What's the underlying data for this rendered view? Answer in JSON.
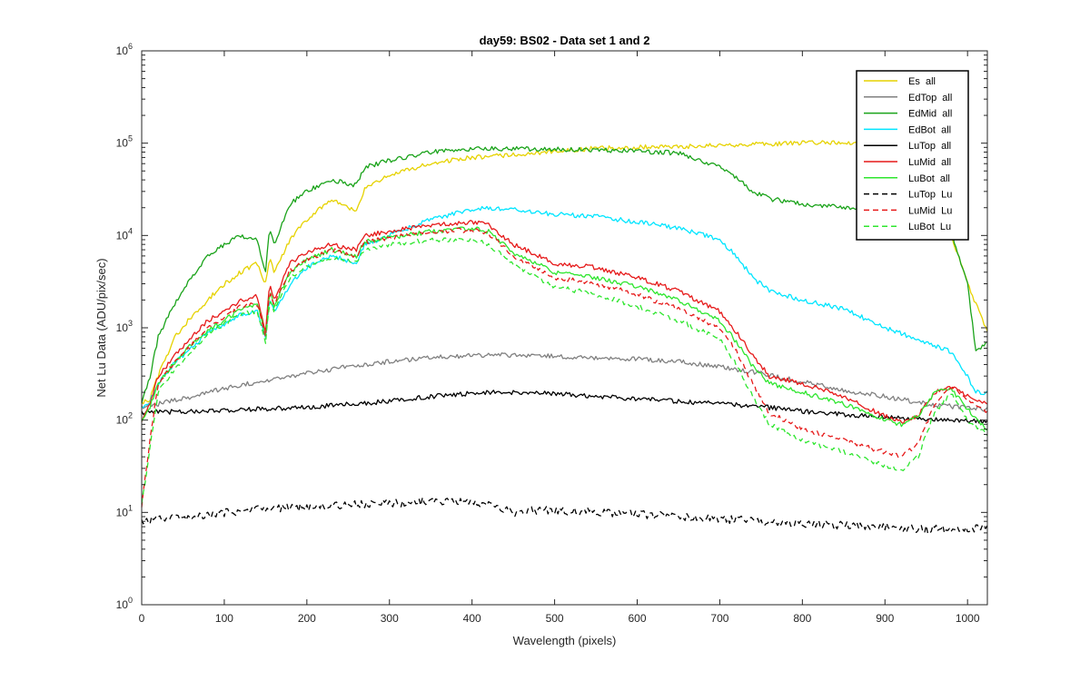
{
  "chart_data": {
    "type": "line",
    "title": "day59: BS02 - Data set 1 and 2",
    "xlabel": "Wavelength (pixels)",
    "ylabel": "Net Lu Data (ADU/pix/sec)",
    "xlim": [
      0,
      1024
    ],
    "ylim": [
      1,
      1000000
    ],
    "yscale": "log",
    "xticks": [
      0,
      100,
      200,
      300,
      400,
      500,
      600,
      700,
      800,
      900,
      1000
    ],
    "yticks": [
      {
        "value": 1,
        "base": "10",
        "exp": "0"
      },
      {
        "value": 10,
        "base": "10",
        "exp": "1"
      },
      {
        "value": 100,
        "base": "10",
        "exp": "2"
      },
      {
        "value": 1000,
        "base": "10",
        "exp": "3"
      },
      {
        "value": 10000,
        "base": "10",
        "exp": "4"
      },
      {
        "value": 100000,
        "base": "10",
        "exp": "5"
      },
      {
        "value": 1000000,
        "base": "10",
        "exp": "6"
      }
    ],
    "grid": false,
    "legend_position": "top-right",
    "series": [
      {
        "name": "Es  all",
        "color": "#e6d200",
        "dash": "solid",
        "x": [
          0,
          10,
          20,
          40,
          60,
          80,
          100,
          120,
          140,
          150,
          155,
          160,
          180,
          200,
          230,
          260,
          270,
          300,
          350,
          400,
          420,
          450,
          500,
          550,
          600,
          650,
          700,
          750,
          800,
          850,
          900,
          950,
          1000,
          1024
        ],
        "y": [
          150,
          170,
          300,
          800,
          1300,
          2000,
          3000,
          4000,
          5000,
          3000,
          6000,
          4000,
          9000,
          15000,
          25000,
          18000,
          33000,
          45000,
          60000,
          70000,
          72000,
          75000,
          82000,
          88000,
          90000,
          92000,
          95000,
          98000,
          100000,
          102000,
          100000,
          60000,
          3000,
          900
        ]
      },
      {
        "name": "EdTop  all",
        "color": "#808080",
        "dash": "solid",
        "x": [
          0,
          20,
          50,
          100,
          150,
          200,
          250,
          300,
          350,
          400,
          430,
          500,
          600,
          650,
          700,
          750,
          800,
          850,
          900,
          950,
          1000,
          1024
        ],
        "y": [
          140,
          150,
          170,
          220,
          270,
          320,
          380,
          430,
          480,
          500,
          510,
          490,
          460,
          430,
          380,
          320,
          260,
          210,
          180,
          150,
          135,
          130
        ]
      },
      {
        "name": "EdMid  all",
        "color": "#1aa31a",
        "dash": "solid",
        "x": [
          0,
          10,
          20,
          40,
          60,
          80,
          100,
          120,
          140,
          150,
          155,
          160,
          180,
          200,
          230,
          260,
          270,
          300,
          350,
          400,
          420,
          450,
          500,
          550,
          600,
          650,
          700,
          720,
          740,
          760,
          800,
          850,
          900,
          950,
          980,
          1000,
          1010,
          1024
        ],
        "y": [
          150,
          300,
          800,
          1800,
          3500,
          6000,
          8000,
          10000,
          9000,
          4000,
          12000,
          8000,
          22000,
          30000,
          40000,
          35000,
          55000,
          65000,
          80000,
          85000,
          88000,
          87000,
          86000,
          84000,
          82000,
          78000,
          55000,
          42000,
          30000,
          25000,
          22000,
          20000,
          17000,
          14000,
          11000,
          3000,
          550,
          700
        ]
      },
      {
        "name": "EdBot  all",
        "color": "#00e5ff",
        "dash": "solid",
        "x": [
          0,
          10,
          20,
          40,
          60,
          80,
          100,
          120,
          140,
          150,
          155,
          160,
          180,
          200,
          230,
          260,
          270,
          300,
          350,
          400,
          420,
          450,
          500,
          550,
          600,
          650,
          700,
          720,
          740,
          760,
          800,
          850,
          900,
          950,
          980,
          1000,
          1010,
          1024
        ],
        "y": [
          130,
          160,
          250,
          420,
          600,
          900,
          1100,
          1400,
          1500,
          800,
          2000,
          1500,
          3000,
          4500,
          6000,
          5000,
          8000,
          10000,
          15000,
          19000,
          20000,
          19000,
          17000,
          16000,
          14000,
          12000,
          9000,
          6000,
          3500,
          2500,
          2000,
          1600,
          1000,
          700,
          550,
          300,
          200,
          200
        ]
      },
      {
        "name": "LuTop  all",
        "color": "#000000",
        "dash": "solid",
        "x": [
          0,
          20,
          50,
          100,
          150,
          200,
          250,
          300,
          350,
          400,
          430,
          500,
          550,
          600,
          650,
          700,
          750,
          800,
          850,
          900,
          950,
          1000,
          1024
        ],
        "y": [
          120,
          122,
          124,
          128,
          132,
          138,
          148,
          160,
          180,
          195,
          200,
          195,
          180,
          170,
          160,
          150,
          140,
          125,
          115,
          108,
          102,
          98,
          95
        ]
      },
      {
        "name": "LuMid  all",
        "color": "#e61919",
        "dash": "solid",
        "x": [
          0,
          10,
          20,
          40,
          60,
          80,
          100,
          120,
          140,
          150,
          155,
          160,
          180,
          200,
          230,
          260,
          270,
          300,
          350,
          400,
          420,
          450,
          500,
          550,
          600,
          650,
          700,
          720,
          740,
          760,
          800,
          850,
          900,
          920,
          940,
          960,
          980,
          1000,
          1024
        ],
        "y": [
          100,
          150,
          300,
          500,
          800,
          1200,
          1500,
          2000,
          2200,
          900,
          3000,
          2000,
          5000,
          6500,
          8000,
          7000,
          10000,
          11000,
          13000,
          14000,
          13000,
          8000,
          5000,
          4500,
          3500,
          2500,
          1500,
          900,
          500,
          300,
          250,
          180,
          110,
          95,
          110,
          200,
          230,
          180,
          150
        ]
      },
      {
        "name": "LuBot  all",
        "color": "#2ee62e",
        "dash": "solid",
        "x": [
          0,
          10,
          20,
          40,
          60,
          80,
          100,
          120,
          140,
          150,
          155,
          160,
          180,
          200,
          230,
          260,
          270,
          300,
          350,
          400,
          420,
          450,
          500,
          550,
          600,
          650,
          700,
          720,
          740,
          760,
          800,
          850,
          900,
          920,
          940,
          960,
          980,
          1000,
          1024
        ],
        "y": [
          100,
          140,
          250,
          420,
          650,
          950,
          1200,
          1600,
          1800,
          800,
          2500,
          1700,
          4000,
          5500,
          7000,
          6000,
          8500,
          9500,
          11000,
          12000,
          11000,
          6500,
          4000,
          3500,
          2800,
          2000,
          1200,
          700,
          380,
          250,
          200,
          150,
          100,
          90,
          110,
          200,
          220,
          130,
          80
        ]
      },
      {
        "name": "LuTop  Lu",
        "color": "#000000",
        "dash": "dashed",
        "x": [
          0,
          20,
          50,
          100,
          150,
          200,
          250,
          300,
          350,
          400,
          430,
          450,
          470,
          500,
          550,
          600,
          650,
          700,
          750,
          800,
          850,
          900,
          950,
          1000,
          1024
        ],
        "y": [
          8,
          8.5,
          9,
          10,
          11,
          11.5,
          12,
          12.5,
          13.5,
          13,
          11.5,
          10,
          10.5,
          10.5,
          10,
          9.5,
          9,
          8.5,
          8,
          7.5,
          7.3,
          7,
          6.5,
          6.8,
          6.5
        ]
      },
      {
        "name": "LuMid  Lu",
        "color": "#e61919",
        "dash": "dashed",
        "x": [
          0,
          10,
          20,
          40,
          60,
          80,
          100,
          120,
          140,
          150,
          155,
          160,
          180,
          200,
          230,
          260,
          270,
          300,
          350,
          400,
          420,
          450,
          500,
          550,
          600,
          650,
          700,
          720,
          740,
          760,
          800,
          850,
          900,
          920,
          940,
          960,
          980,
          1000,
          1024
        ],
        "y": [
          12,
          60,
          250,
          420,
          650,
          1000,
          1300,
          1700,
          1800,
          800,
          2500,
          1700,
          4200,
          5500,
          7000,
          6000,
          8500,
          9500,
          11000,
          11500,
          10500,
          6000,
          3500,
          3000,
          2300,
          1600,
          1000,
          550,
          250,
          120,
          80,
          60,
          45,
          40,
          55,
          150,
          230,
          160,
          120
        ]
      },
      {
        "name": "LuBot  Lu",
        "color": "#2ee62e",
        "dash": "dashed",
        "x": [
          0,
          10,
          20,
          40,
          60,
          80,
          100,
          120,
          140,
          150,
          155,
          160,
          180,
          200,
          230,
          260,
          270,
          300,
          350,
          400,
          420,
          450,
          500,
          550,
          600,
          650,
          700,
          720,
          740,
          760,
          800,
          850,
          900,
          920,
          940,
          960,
          980,
          1000,
          1024
        ],
        "y": [
          12,
          50,
          200,
          350,
          550,
          850,
          1100,
          1400,
          1500,
          700,
          2000,
          1500,
          3500,
          4500,
          5800,
          5000,
          7000,
          8000,
          9000,
          9000,
          8000,
          4800,
          2800,
          2300,
          1700,
          1200,
          750,
          400,
          180,
          90,
          60,
          45,
          32,
          28,
          40,
          120,
          200,
          100,
          70
        ]
      }
    ]
  }
}
